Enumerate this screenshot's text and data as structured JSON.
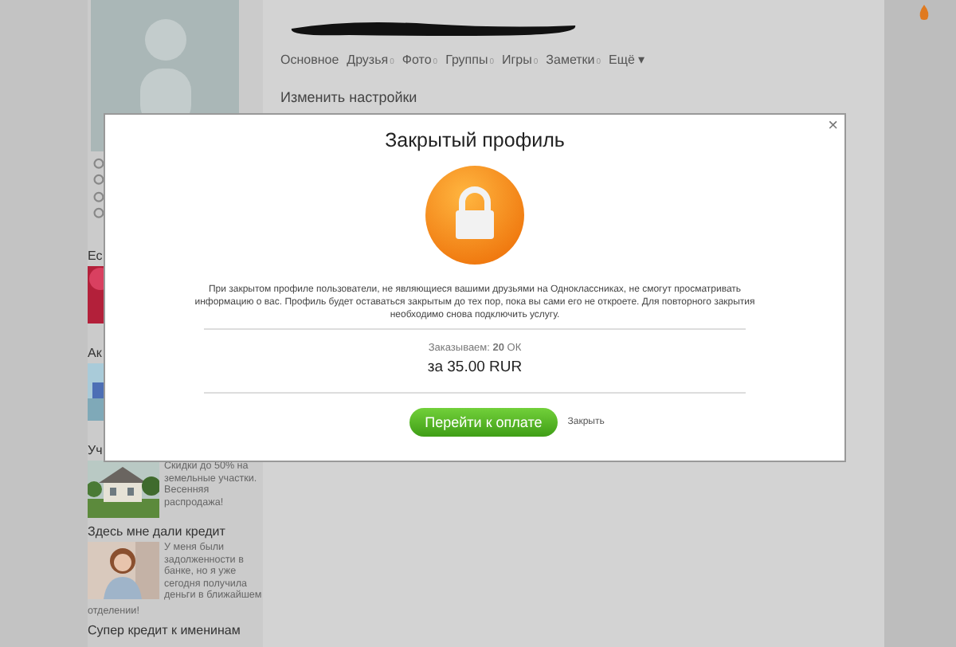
{
  "profile": {
    "nav": [
      {
        "label": "Основное",
        "selected": false
      },
      {
        "label": "Друзья",
        "count": "0",
        "selected": false
      },
      {
        "label": "Фото",
        "count": "0",
        "selected": false
      },
      {
        "label": "Группы",
        "count": "0",
        "selected": false
      },
      {
        "label": "Игры",
        "count": "0",
        "selected": false
      },
      {
        "label": "Заметки",
        "count": "0",
        "selected": false
      },
      {
        "label": "Ещё ▾",
        "selected": false
      }
    ],
    "settings_link": "Изменить настройки"
  },
  "ads": [
    {
      "title": "Ес",
      "kind": "red"
    },
    {
      "title": "Ак",
      "kind": "sky"
    },
    {
      "title": "Уч",
      "text": "Скидки до 50% на земельные участки. Весенняя распродажа!",
      "kind": "house"
    },
    {
      "title": "Здесь мне дали кредит",
      "text": "У меня были задолженности в банке, но я уже сегодня получила деньги в ближайшем",
      "tail": "отделении!",
      "kind": "person"
    },
    {
      "title": "Супер кредит к именинам",
      "kind": "none"
    }
  ],
  "dialog": {
    "title": "Закрытый профиль",
    "close": "×",
    "message": "При закрытом профиле пользователи, не являющиеся вашими друзьями на Одноклассниках, не смогут просматривать информацию о вас. Профиль будет оставаться закрытым до тех пор, пока вы сами его не откроете. Для повторного закрытия необходимо снова подключить услугу.",
    "order": "Заказываем: **20** ОК",
    "price": "за 35.00 RUR",
    "pay_button": "Перейти к оплате",
    "close_link": "Закрыть"
  }
}
